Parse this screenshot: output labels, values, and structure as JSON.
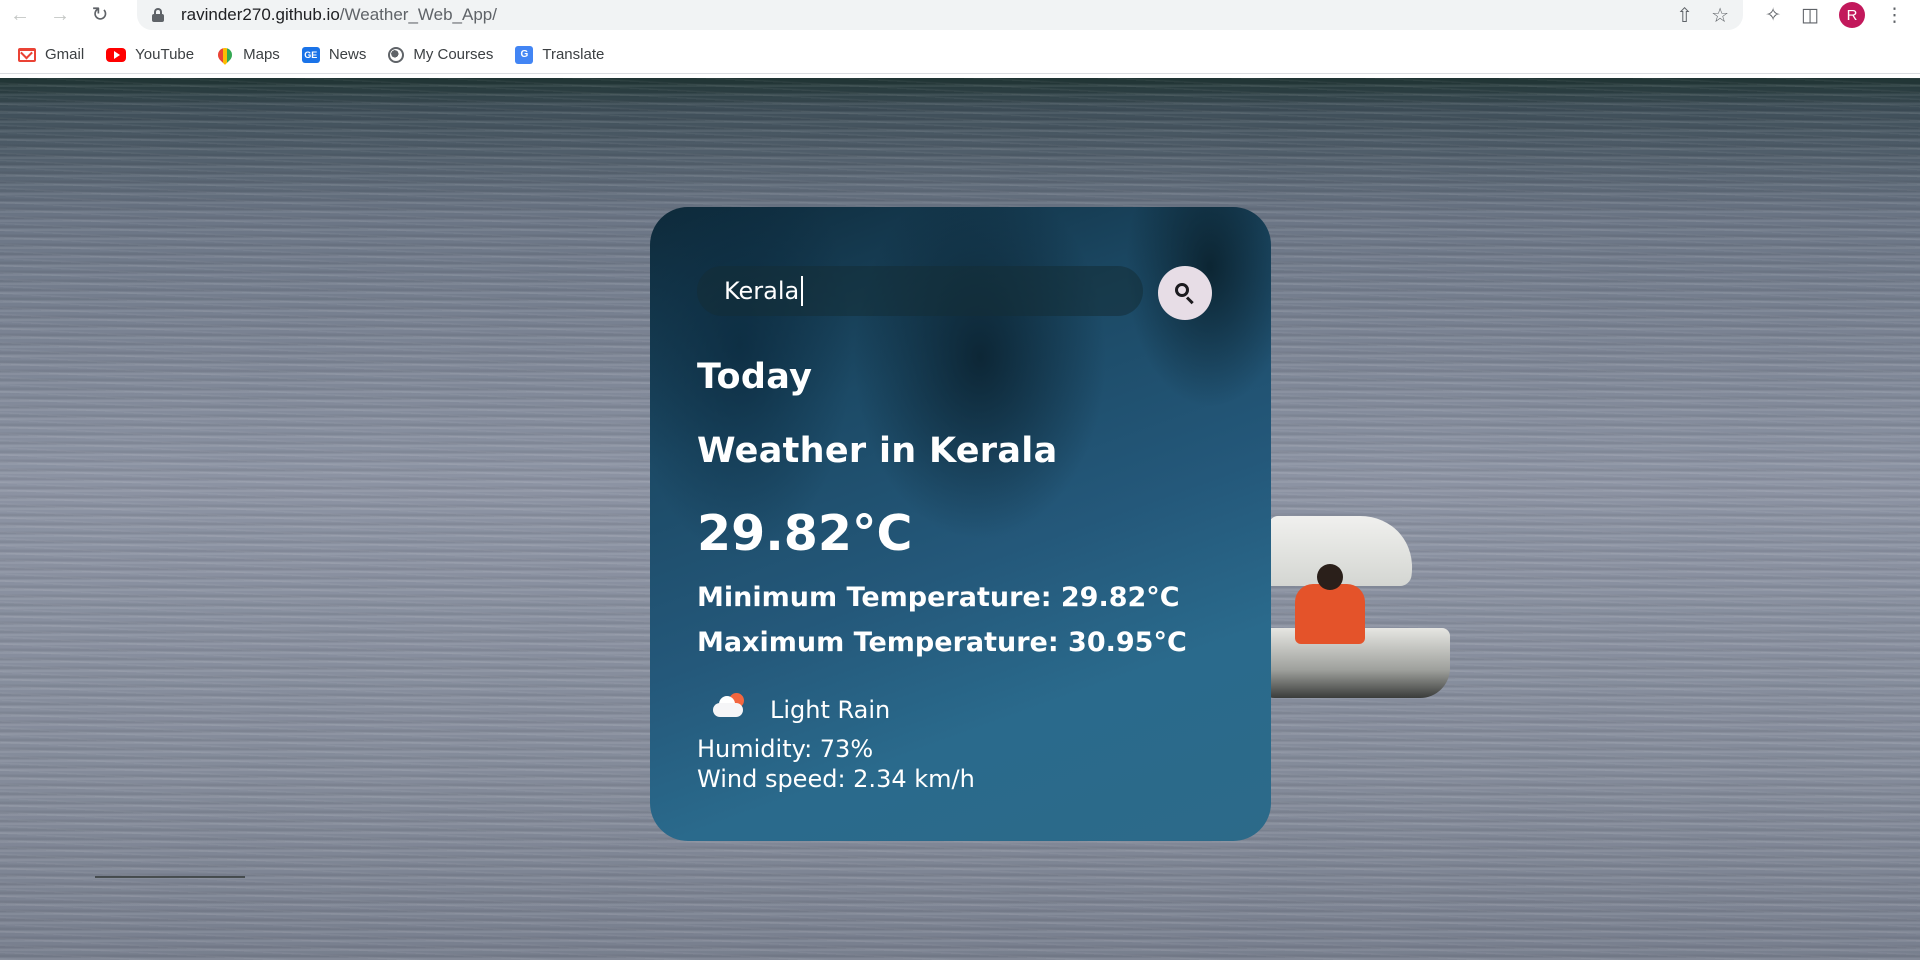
{
  "browser": {
    "url_host": "ravinder270.github.io",
    "url_path": "/Weather_Web_App/",
    "profile_initial": "R",
    "bookmarks": [
      {
        "label": "Gmail",
        "icon": "gmail-icon"
      },
      {
        "label": "YouTube",
        "icon": "youtube-icon"
      },
      {
        "label": "Maps",
        "icon": "maps-icon"
      },
      {
        "label": "News",
        "icon": "news-icon"
      },
      {
        "label": "My Courses",
        "icon": "globe-icon"
      },
      {
        "label": "Translate",
        "icon": "translate-icon"
      }
    ]
  },
  "weather": {
    "search_value": "Kerala",
    "search_icon": "magnifier-icon",
    "heading_today": "Today",
    "city_heading": "Weather in Kerala",
    "temperature": "29.82°C",
    "min_temperature": "Minimum Temperature: 29.82°C",
    "max_temperature": "Maximum Temperature: 30.95°C",
    "condition_icon": "cloud-sun-icon",
    "description": "Light Rain",
    "humidity": "Humidity: 73%",
    "wind_speed": "Wind speed: 2.34 km/h"
  },
  "colors": {
    "card_accent": "#24587a",
    "search_button": "#e7dde6",
    "avatar": "#c2185b"
  }
}
